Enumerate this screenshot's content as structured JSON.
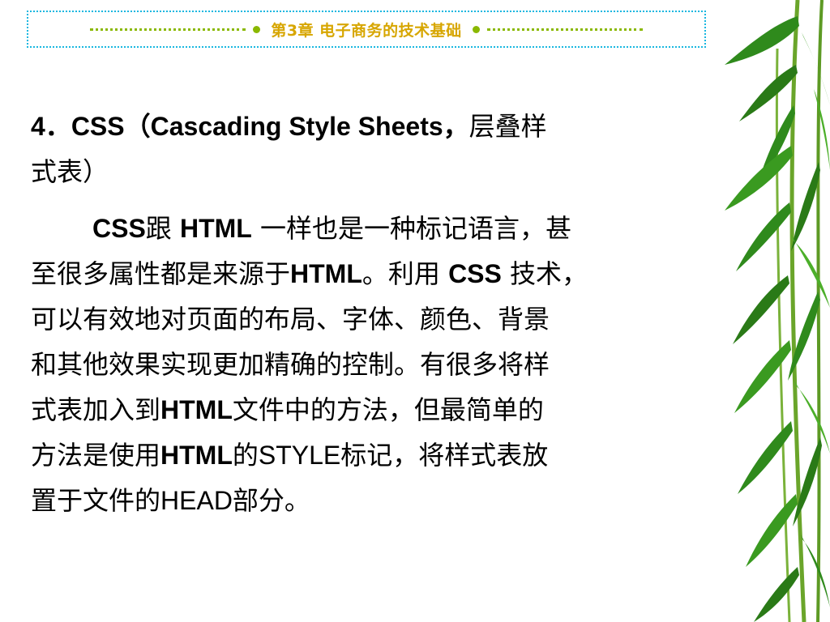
{
  "header": {
    "title": "第3章  电子商务的技术基础"
  },
  "heading": {
    "number": "4．",
    "latin": "CSS（Cascading  Style  Sheets，",
    "cn_line1": "层叠样",
    "cn_line2": "式表）"
  },
  "paragraph": {
    "l1_a": "CSS",
    "l1_b": "跟 ",
    "l1_c": "HTML",
    "l1_d": " 一样也是一种标记语言，甚",
    "l2_a": "至很多属性都是来源于",
    "l2_b": "HTML",
    "l2_c": "。利用 ",
    "l2_d": "CSS",
    "l2_e": " 技术，",
    "l3": "可以有效地对页面的布局、字体、颜色、背景",
    "l4": "和其他效果实现更加精确的控制。有很多将样",
    "l5_a": "式表加入到",
    "l5_b": "HTML",
    "l5_c": "文件中的方法，但最简单的",
    "l6_a": "方法是使用",
    "l6_b": "HTML",
    "l6_c": "的",
    "l6_d": "STYLE",
    "l6_e": "标记，将样式表放",
    "l7_a": "置于文件的",
    "l7_b": "HEAD",
    "l7_c": "部分。"
  },
  "colors": {
    "header_border": "#19b7e0",
    "header_dots": "#8ab800",
    "header_text": "#d7a600",
    "bamboo_leaf": "#2f8a1c",
    "bamboo_stem": "#6aa52a"
  },
  "decoration": {
    "bamboo": "bamboo-leaves-image"
  }
}
